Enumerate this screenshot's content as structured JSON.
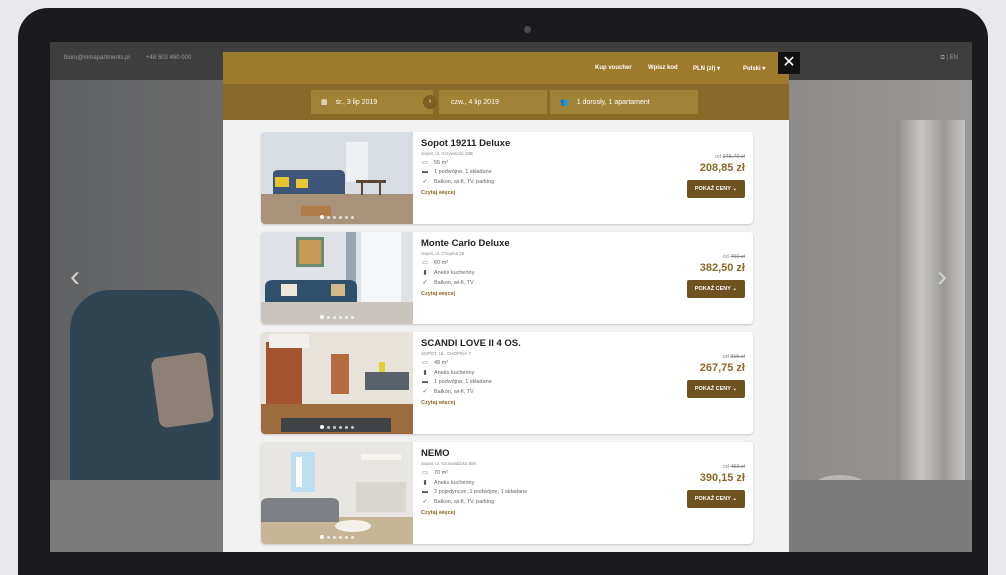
{
  "background_site": {
    "contact_email": "biuro@mmapartments.pl",
    "contact_phone": "+48 503 460 000",
    "top_right": "⧉ | EN",
    "nav_prev_icon": "chevron-left-icon",
    "nav_next_icon": "chevron-right-icon"
  },
  "header": {
    "links": [
      "Kup voucher",
      "Wpisz kod",
      "PLN (zł) ▾",
      "Polski ▾"
    ]
  },
  "search": {
    "checkin": "śr., 3 lip 2019",
    "checkout": "czw., 4 lip 2019",
    "guests": "1 dorosły, 1 apartament"
  },
  "listings": [
    {
      "title": "Sopot 19211 Deluxe",
      "address": "Sopot, ul. Grzywacza 19B",
      "features": [
        "55 m²",
        "1 podwójne, 1 składane",
        "Balkon, wi-fi, TV, parking"
      ],
      "feature_icons": [
        "area-icon",
        "bed-icon",
        "check-icon"
      ],
      "read_more": "Czytaj więcej",
      "old_price_prefix": "od",
      "old_price": "245,70 zł",
      "price": "208,85 zł",
      "button": "POKAŻ CENY ⌄"
    },
    {
      "title": "Monte Carlo Deluxe",
      "address": "Sopot, ul. Chopina 29",
      "features": [
        "60 m²",
        "Aneks kuchenny",
        "Balkon, wi-fi, TV"
      ],
      "feature_icons": [
        "area-icon",
        "kitchen-icon",
        "check-icon"
      ],
      "read_more": "Czytaj więcej",
      "old_price_prefix": "od",
      "old_price": "450 zł",
      "price": "382,50 zł",
      "button": "POKAŻ CENY ⌄"
    },
    {
      "title": "SCANDI LOVE II 4 OS.",
      "address": "SOPOT, UL. CHOPINA 7",
      "features": [
        "48 m²",
        "Aneks kuchenny",
        "1 podwójne, 1 składane",
        "Balkon, wi-fi, TV"
      ],
      "feature_icons": [
        "area-icon",
        "kitchen-icon",
        "bed-icon",
        "check-icon"
      ],
      "read_more": "Czytaj więcej",
      "old_price_prefix": "od",
      "old_price": "315 zł",
      "price": "267,75 zł",
      "button": "POKAŻ CENY ⌄"
    },
    {
      "title": "NEMO",
      "address": "Sopot, ul. Grunwaldzka 88A",
      "features": [
        "70 m²",
        "Aneks kuchenny",
        "2 pojedyncze, 1 podwójne, 1 składane",
        "Balkon, wi-fi, TV, parking"
      ],
      "feature_icons": [
        "area-icon",
        "kitchen-icon",
        "bed-icon",
        "check-icon"
      ],
      "read_more": "Czytaj więcej",
      "old_price_prefix": "od",
      "old_price": "459 zł",
      "price": "390,15 zł",
      "button": "POKAŻ CENY ⌄"
    }
  ],
  "close_label": "✕"
}
